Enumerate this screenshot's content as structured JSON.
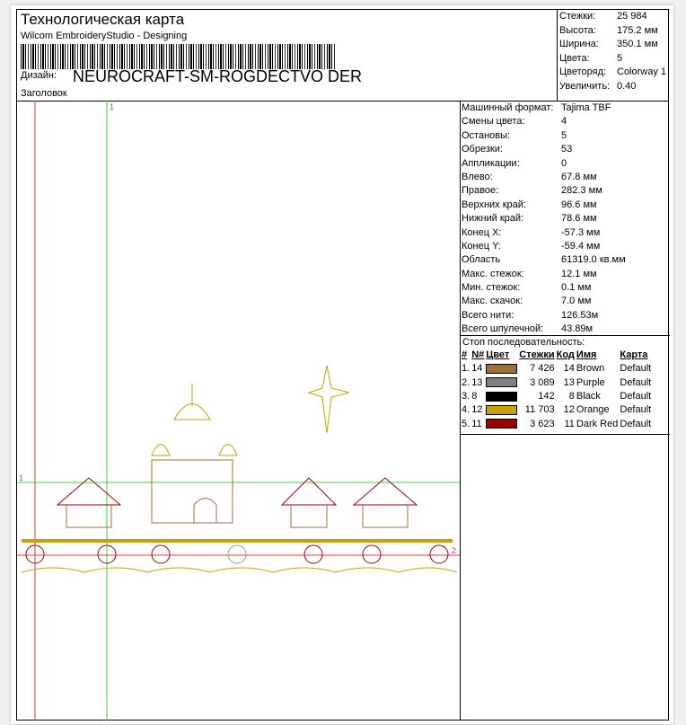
{
  "header": {
    "title": "Технологическая карта",
    "subtitle": "Wilcom EmbroideryStudio - Designing",
    "design_label": "Дизайн:",
    "design_name": "NEUROCRAFT-SM-ROGDECTVO DER",
    "heading_label": "Заголовок"
  },
  "stats": [
    {
      "k": "Стежки:",
      "v": "25 984"
    },
    {
      "k": "Высота:",
      "v": "175.2 мм"
    },
    {
      "k": "Ширина:",
      "v": "350.1 мм"
    },
    {
      "k": "Цвета:",
      "v": "5"
    },
    {
      "k": "Цветоряд:",
      "v": "Colorway 1"
    },
    {
      "k": "Увеличить:",
      "v": "0.40"
    }
  ],
  "info": [
    {
      "k": "Машинный формат:",
      "v": "Tajima TBF"
    },
    {
      "k": "Смены цвета:",
      "v": "4"
    },
    {
      "k": "Остановы:",
      "v": "5"
    },
    {
      "k": "Обрезки:",
      "v": "53"
    },
    {
      "k": "Аппликации:",
      "v": "0"
    },
    {
      "k": "Влево:",
      "v": "67.8 мм"
    },
    {
      "k": "Правое:",
      "v": "282.3 мм"
    },
    {
      "k": "Верхних край:",
      "v": "96.6 мм"
    },
    {
      "k": "Нижний край:",
      "v": "78.6 мм"
    },
    {
      "k": "Конец X:",
      "v": "-57.3 мм"
    },
    {
      "k": "Конец Y:",
      "v": "-59.4 мм"
    },
    {
      "k": "Область",
      "v": "61319.0 кв.мм"
    },
    {
      "k": "Макс. стежок:",
      "v": "12.1 мм"
    },
    {
      "k": "Мин. стежок:",
      "v": "0.1 мм"
    },
    {
      "k": "Макс. скачок:",
      "v": "7.0 мм"
    },
    {
      "k": "Всего нити:",
      "v": "126.53м"
    },
    {
      "k": "Всего шпулечной:",
      "v": "43.89м"
    }
  ],
  "stop": {
    "title": "Стоп последовательность:",
    "headers": [
      "#",
      "N#",
      "Цвет",
      "Стежки",
      "Код",
      "Имя",
      "Карта"
    ],
    "rows": [
      {
        "i": "1.",
        "n": "14",
        "color": "#a0703a",
        "st": "7 426",
        "code": "14",
        "name": "Brown",
        "map": "Default"
      },
      {
        "i": "2.",
        "n": "13",
        "color": "#808080",
        "st": "3 089",
        "code": "13",
        "name": "Purple",
        "map": "Default"
      },
      {
        "i": "3.",
        "n": "8",
        "color": "#000000",
        "st": "142",
        "code": "8",
        "name": "Black",
        "map": "Default"
      },
      {
        "i": "4.",
        "n": "12",
        "color": "#c8a000",
        "st": "11 703",
        "code": "12",
        "name": "Orange",
        "map": "Default"
      },
      {
        "i": "5.",
        "n": "11",
        "color": "#9a0000",
        "st": "3 623",
        "code": "11",
        "name": "Dark Red",
        "map": "Default"
      }
    ]
  },
  "guides": {
    "v1": "1",
    "h1": "1",
    "h2": "2"
  }
}
